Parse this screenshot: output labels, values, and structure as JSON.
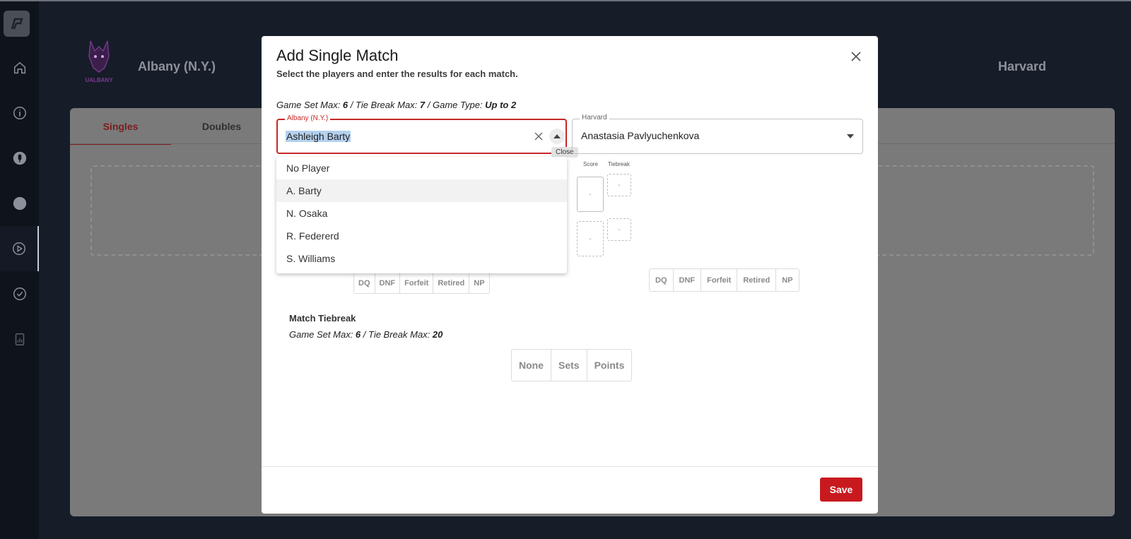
{
  "sidebar": {
    "items": [
      {
        "icon": "home-icon"
      },
      {
        "icon": "info-icon"
      },
      {
        "icon": "microphone-icon"
      },
      {
        "icon": "circle-icon"
      },
      {
        "icon": "play-circle-icon",
        "active": true
      },
      {
        "icon": "check-circle-icon"
      },
      {
        "icon": "clipboard-chart-icon"
      }
    ]
  },
  "header": {
    "left_team": "Albany (N.Y.)",
    "right_team": "Harvard",
    "logo_caption": "UALBANY"
  },
  "panel": {
    "tabs": [
      "Singles",
      "Doubles"
    ]
  },
  "modal": {
    "title": "Add Single Match",
    "subtitle": "Select the players and enter the results for each match.",
    "rules": {
      "game_set_label": "Game Set Max: ",
      "game_set_value": "6",
      "tie_break_label": " / Tie Break Max: ",
      "tie_break_value": "7",
      "game_type_label": " / Game Type: ",
      "game_type_value": "Up to 2"
    },
    "left_field": {
      "label": "Albany (N.Y.)",
      "value": "Ashleigh Barty",
      "tooltip": "Close"
    },
    "right_field": {
      "label": "Harvard",
      "value": "Anastasia Pavlyuchenkova"
    },
    "options": [
      "No Player",
      "A. Barty",
      "N. Osaka",
      "R. Federerd",
      "S. Williams"
    ],
    "score_head": "Score",
    "tiebreak_head": "Tiebreak",
    "placeholder": "-",
    "status_buttons": [
      "DQ",
      "DNF",
      "Forfeit",
      "Retired",
      "NP"
    ],
    "match_tiebreak": {
      "title": "Match Tiebreak",
      "game_set_label": "Game Set Max: ",
      "game_set_value": "6",
      "tie_break_label": " / Tie Break Max: ",
      "tie_break_value": "20",
      "options": [
        "None",
        "Sets",
        "Points"
      ]
    },
    "save_label": "Save"
  },
  "colors": {
    "accent_red": "#c8191f",
    "field_error": "#c62828",
    "background_dark": "#151a26"
  }
}
